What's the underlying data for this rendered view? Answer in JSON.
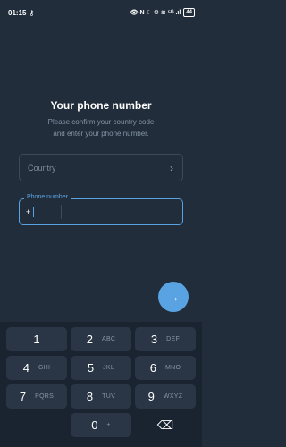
{
  "status_bar": {
    "time": "01:15",
    "key_icon": "key-icon",
    "right_text": "👁 N ☾ ⚙ ≋ ⁵ᴳ .ıl",
    "battery": "44"
  },
  "screen": {
    "title": "Your phone number",
    "subtitle_line1": "Please confirm your country code",
    "subtitle_line2": "and enter your phone number."
  },
  "country_field": {
    "placeholder": "Country",
    "chevron": "›"
  },
  "phone_field": {
    "label": "Phone number",
    "code": "+"
  },
  "fab": {
    "icon": "→"
  },
  "keypad": {
    "keys": [
      {
        "num": "1",
        "letters": ""
      },
      {
        "num": "2",
        "letters": "ABC"
      },
      {
        "num": "3",
        "letters": "DEF"
      },
      {
        "num": "4",
        "letters": "GHI"
      },
      {
        "num": "5",
        "letters": "JKL"
      },
      {
        "num": "6",
        "letters": "MNO"
      },
      {
        "num": "7",
        "letters": "PQRS"
      },
      {
        "num": "8",
        "letters": "TUV"
      },
      {
        "num": "9",
        "letters": "WXYZ"
      },
      {
        "num": "0",
        "letters": "+"
      }
    ],
    "backspace_icon": "⌫"
  }
}
